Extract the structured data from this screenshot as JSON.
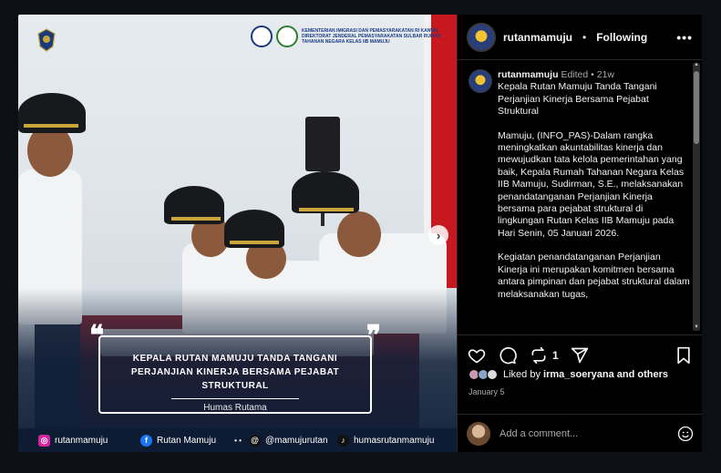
{
  "post": {
    "image": {
      "overlay_title": "KEPALA RUTAN MAMUJU TANDA TANGANI PERJANJIAN KINERJA BERSAMA PEJABAT STRUKTURAL",
      "overlay_subtitle": "Humas Rutama",
      "header_org_text": "KEMENTERIAN IMIGRASI DAN PEMASYARAKATAN RI KANWIL DIREKTORAT JENDERAL PEMASYARAKATAN SULBAR RUMAH TAHANAN NEGARA KELAS IIB MAMUJU",
      "social": [
        {
          "icon": "instagram-icon",
          "label": "rutanmamuju",
          "color": "#d6249f"
        },
        {
          "icon": "facebook-icon",
          "label": "Rutan Mamuju",
          "color": "#1877f2"
        },
        {
          "icon": "threads-icon",
          "label": "@mamujurutan",
          "color": "#111111"
        },
        {
          "icon": "tiktok-icon",
          "label": "humasrutanmamuju",
          "color": "#111111"
        }
      ]
    },
    "header": {
      "username": "rutanmamuju",
      "separator": "•",
      "follow_status": "Following",
      "more_icon": "more-options-icon"
    },
    "caption": {
      "username": "rutanmamuju",
      "edited": "Edited",
      "dot": "•",
      "age": "21w",
      "paragraphs": [
        "Kepala Rutan Mamuju Tanda Tangani Perjanjian Kinerja Bersama Pejabat Struktural",
        "Mamuju, (INFO_PAS)-Dalam rangka meningkatkan akuntabilitas kinerja dan mewujudkan tata kelola pemerintahan yang baik, Kepala Rumah Tahanan Negara Kelas IIB Mamuju, Sudirman, S.E., melaksanakan penandatanganan Perjanjian Kinerja bersama para pejabat struktural di lingkungan Rutan Kelas IIB Mamuju pada Hari Senin, 05 Januari 2026.",
        "Kegiatan penandatanganan Perjanjian Kinerja ini merupakan komitmen bersama antara pimpinan dan pejabat struktural dalam melaksanakan tugas,"
      ]
    },
    "actions": {
      "repost_count": "1"
    },
    "likes": {
      "prefix": "Liked by",
      "user": "irma_soeryana",
      "suffix": "and others"
    },
    "date": "January 5",
    "comment": {
      "placeholder": "Add a comment..."
    }
  },
  "colors": {
    "background": "#0c0f14",
    "panel": "#000000",
    "text": "#f5f5f5",
    "muted": "#a8a8a8",
    "overlay_navy": "#0d1b33"
  }
}
